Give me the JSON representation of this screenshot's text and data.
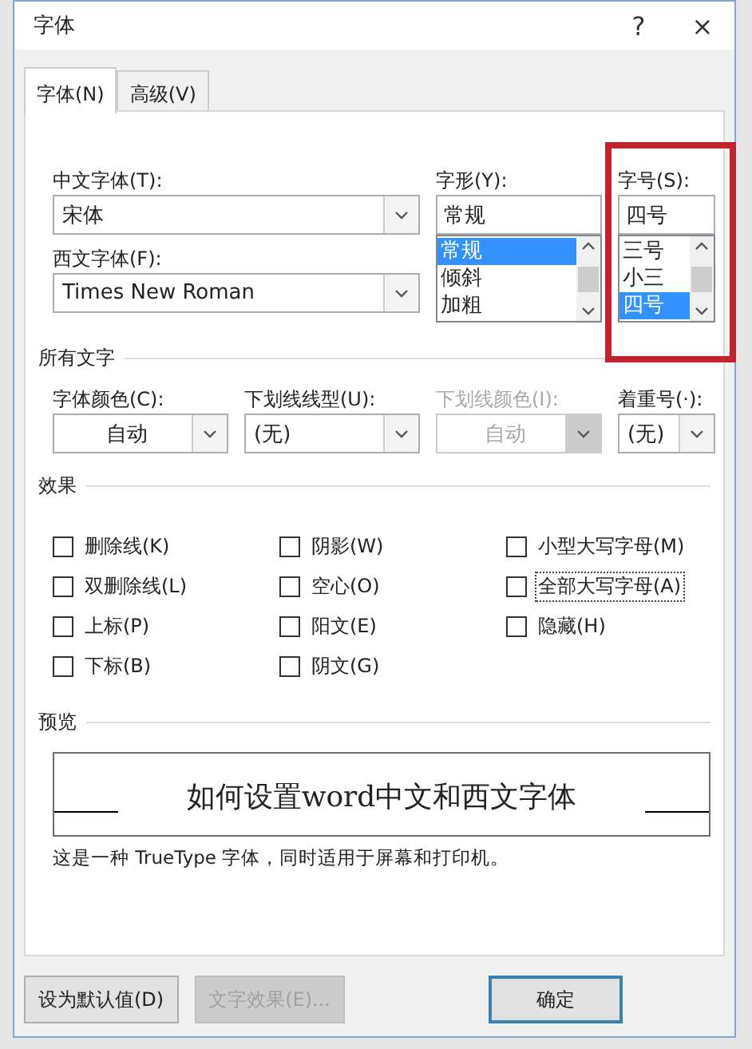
{
  "window": {
    "title": "字体",
    "help": "?",
    "close": "×"
  },
  "tabs": [
    {
      "label": "字体(N)",
      "selected": true
    },
    {
      "label": "高级(V)",
      "selected": false
    }
  ],
  "chinese_font": {
    "label": "中文字体(T):",
    "value": "宋体"
  },
  "western_font": {
    "label": "西文字体(F):",
    "value": "Times New Roman"
  },
  "style": {
    "label": "字形(Y):",
    "value": "常规",
    "options": [
      {
        "label": "常规",
        "selected": true
      },
      {
        "label": "倾斜",
        "selected": false
      },
      {
        "label": "加粗",
        "selected": false
      }
    ]
  },
  "size": {
    "label": "字号(S):",
    "value": "四号",
    "highlighted": true,
    "options": [
      {
        "label": "三号",
        "selected": false
      },
      {
        "label": "小三",
        "selected": false
      },
      {
        "label": "四号",
        "selected": true
      }
    ]
  },
  "all_text": {
    "title": "所有文字",
    "fields": [
      {
        "label": "字体颜色(C):",
        "value": "自动",
        "kind": "color",
        "disabled": false
      },
      {
        "label": "下划线线型(U):",
        "value": "(无)",
        "kind": "choice",
        "disabled": false
      },
      {
        "label": "下划线颜色(I):",
        "value": "自动",
        "kind": "color",
        "disabled": true
      },
      {
        "label": "着重号(·):",
        "value": "(无)",
        "kind": "choice",
        "disabled": false
      }
    ]
  },
  "effects": {
    "title": "效果",
    "items": [
      {
        "label": "删除线(K)",
        "checked": false,
        "focused": false
      },
      {
        "label": "阴影(W)",
        "checked": false,
        "focused": false
      },
      {
        "label": "小型大写字母(M)",
        "checked": false,
        "focused": false
      },
      {
        "label": "双删除线(L)",
        "checked": false,
        "focused": false
      },
      {
        "label": "空心(O)",
        "checked": false,
        "focused": false
      },
      {
        "label": "全部大写字母(A)",
        "checked": false,
        "focused": true
      },
      {
        "label": "上标(P)",
        "checked": false,
        "focused": false
      },
      {
        "label": "阳文(E)",
        "checked": false,
        "focused": false
      },
      {
        "label": "隐藏(H)",
        "checked": false,
        "focused": false
      },
      {
        "label": "下标(B)",
        "checked": false,
        "focused": false
      },
      {
        "label": "阴文(G)",
        "checked": false,
        "focused": false
      }
    ]
  },
  "preview": {
    "title": "预览",
    "sample": "如何设置word中文和西文字体",
    "note": "这是一种 TrueType 字体，同时适用于屏幕和打印机。"
  },
  "buttons": [
    {
      "label": "设为默认值(D)",
      "disabled": false,
      "kind": "secondary"
    },
    {
      "label": "文字效果(E)...",
      "disabled": true,
      "kind": "secondary"
    },
    {
      "label": "确定",
      "disabled": false,
      "kind": "primary"
    }
  ]
}
